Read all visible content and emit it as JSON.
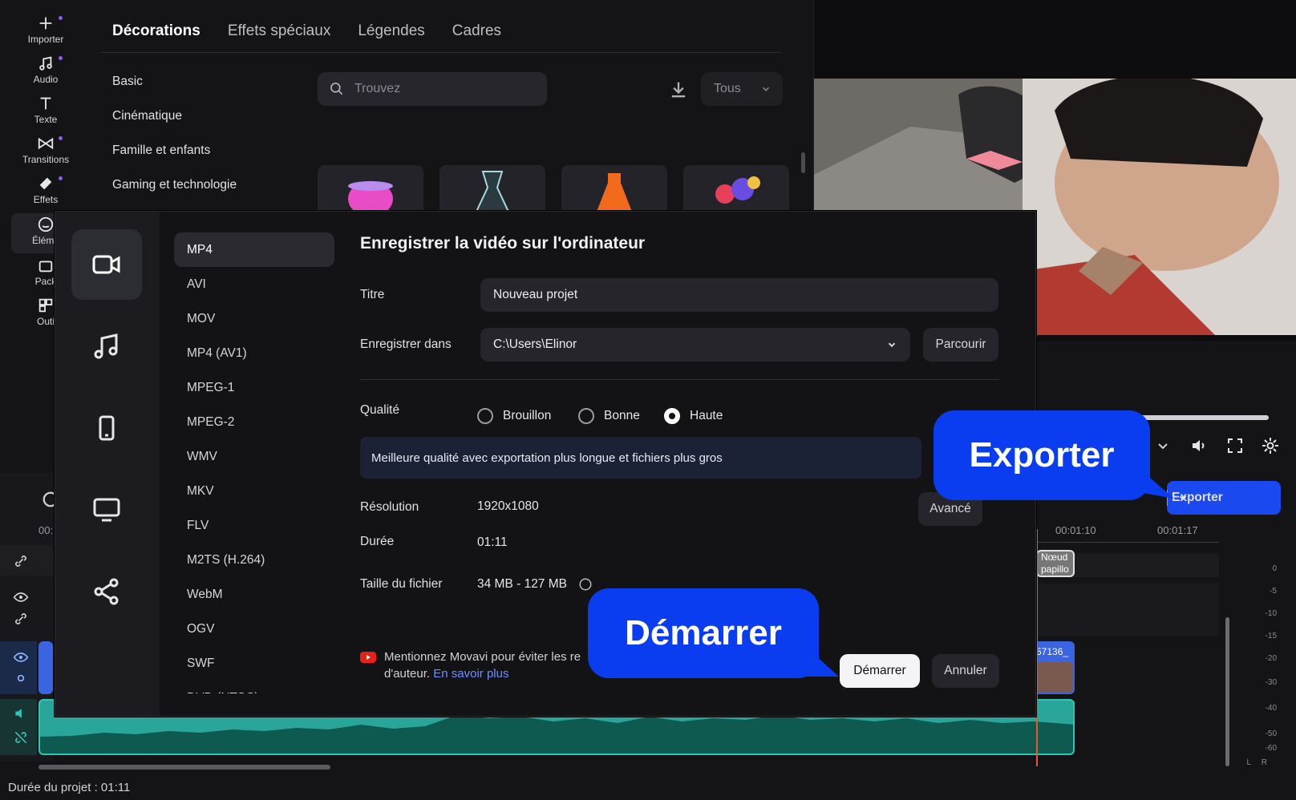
{
  "rail": {
    "items": [
      {
        "label": "Importer",
        "icon": "plus-icon"
      },
      {
        "label": "Audio",
        "icon": "music-icon"
      },
      {
        "label": "Texte",
        "icon": "text-icon"
      },
      {
        "label": "Transitions",
        "icon": "transitions-icon"
      },
      {
        "label": "Effets",
        "icon": "effects-icon"
      },
      {
        "label": "Éléme",
        "icon": "smiley-icon"
      },
      {
        "label": "Pack",
        "icon": "pack-icon"
      },
      {
        "label": "Outi",
        "icon": "tools-icon"
      }
    ]
  },
  "library": {
    "tabs": [
      "Décorations",
      "Effets spéciaux",
      "Légendes",
      "Cadres"
    ],
    "active_tab": "Décorations",
    "categories": [
      "Basic",
      "Cinématique",
      "Famille et enfants",
      "Gaming et technologie"
    ],
    "search_placeholder": "Trouvez",
    "filter_value": "Tous"
  },
  "modal": {
    "title": "Enregistrer la vidéo sur l'ordinateur",
    "formats": [
      "MP4",
      "AVI",
      "MOV",
      "MP4 (AV1)",
      "MPEG-1",
      "MPEG-2",
      "WMV",
      "MKV",
      "FLV",
      "M2TS (H.264)",
      "WebM",
      "OGV",
      "SWF",
      "DVD (NTSC)"
    ],
    "active_format": "MP4",
    "title_label": "Titre",
    "title_value": "Nouveau projet",
    "save_label": "Enregistrer dans",
    "save_value": "C:\\Users\\Elinor",
    "browse_label": "Parcourir",
    "quality_label": "Qualité",
    "quality_options": [
      "Brouillon",
      "Bonne",
      "Haute"
    ],
    "quality_selected": "Haute",
    "quality_info": "Meilleure qualité avec exportation plus longue et fichiers plus gros",
    "resolution_label": "Résolution",
    "resolution_value": "1920x1080",
    "advanced_label": "Avancé",
    "duration_label": "Durée",
    "duration_value": "01:11",
    "filesize_label": "Taille du fichier",
    "filesize_value": "34 MB - 127 MB",
    "yt_line1": "Mentionnez Movavi pour éviter les re",
    "yt_line2": "d'auteur.",
    "yt_link": "En savoir plus",
    "start_label": "Démarrer",
    "cancel_label": "Annuler"
  },
  "export_button": {
    "label": "Exporter"
  },
  "callouts": {
    "export": "Exporter",
    "start": "Démarrer"
  },
  "timeline": {
    "ruler": [
      "00:01:10",
      "00:01:17",
      "00:"
    ],
    "clip_label_1": "Nœud",
    "clip_label_2": "papillo",
    "clip_code": "57136_",
    "project_duration": "Durée du projet : 01:11",
    "meter_labels": [
      "0",
      "-5",
      "-10",
      "-15",
      "-20",
      "-30",
      "-40",
      "-50",
      "-60"
    ],
    "meter_lr": [
      "L",
      "R"
    ]
  },
  "colors": {
    "accent": "#1a49f0",
    "callout": "#0a3df0",
    "audio_track": "#2aa59a"
  }
}
